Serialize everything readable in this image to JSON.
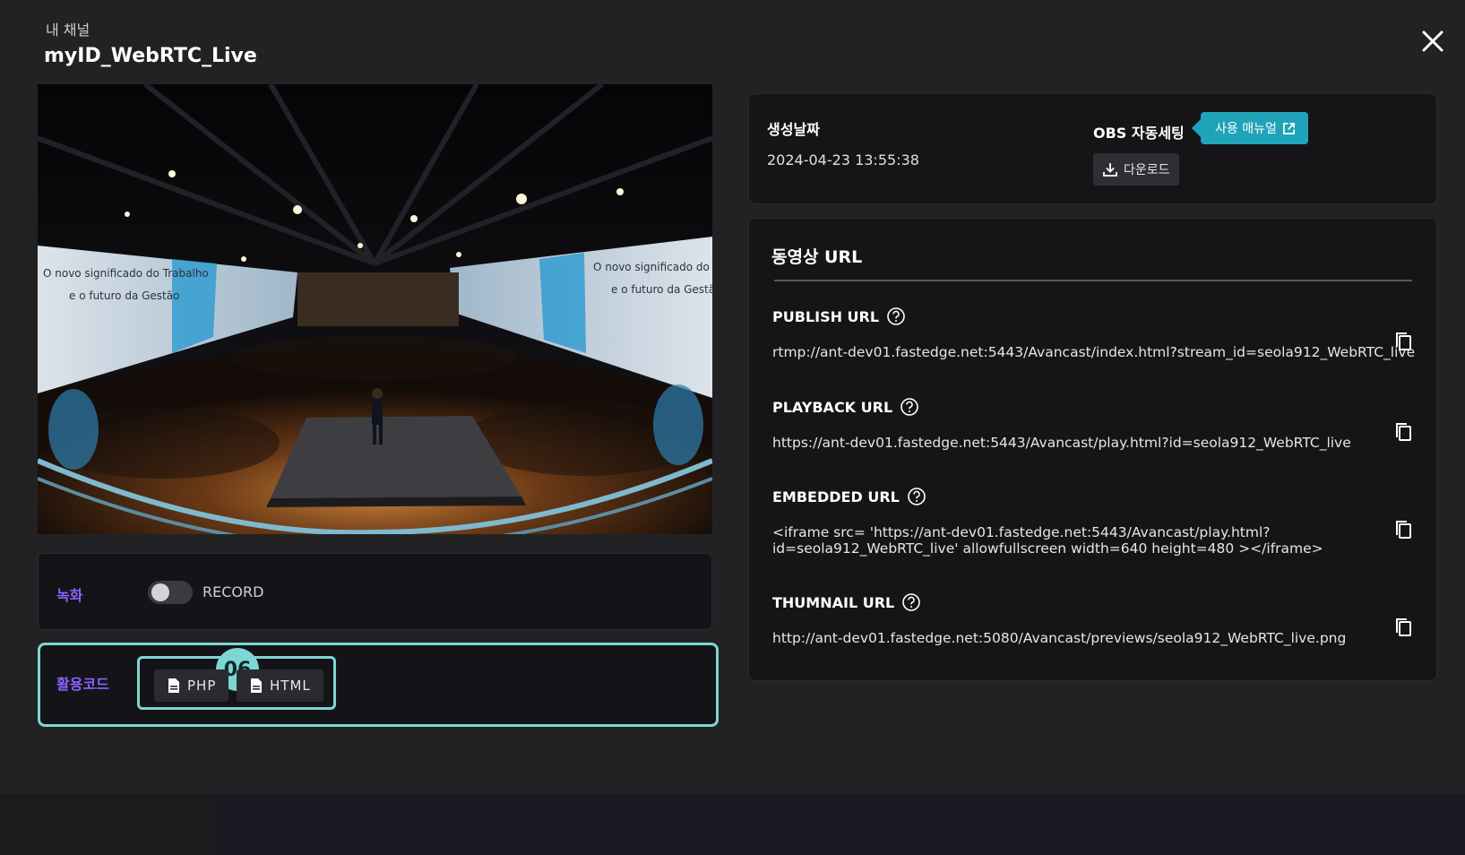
{
  "header": {
    "subtitle": "내 채널",
    "title": "myID_WebRTC_Live"
  },
  "recording": {
    "label": "녹화",
    "toggle_on": false,
    "toggle_text": "RECORD"
  },
  "code": {
    "label": "활용코드",
    "badge": "06",
    "buttons": [
      "PHP",
      "HTML"
    ]
  },
  "info": {
    "created_label": "생성날짜",
    "created_value": "2024-04-23 13:55:38",
    "obs_label": "OBS 자동세팅",
    "manual_button": "사용 매뉴얼",
    "download_button": "다운로드"
  },
  "urls": {
    "title": "동영상 URL",
    "items": [
      {
        "name": "PUBLISH URL",
        "value": "rtmp://ant-dev01.fastedge.net:5443/Avancast/index.html?stream_id=seola912_WebRTC_live",
        "value2": ""
      },
      {
        "name": "PLAYBACK URL",
        "value": "https://ant-dev01.fastedge.net:5443/Avancast/play.html?id=seola912_WebRTC_live",
        "value2": ""
      },
      {
        "name": "EMBEDDED URL",
        "value": "<iframe src= 'https://ant-dev01.fastedge.net:5443/Avancast/play.html?",
        "value2": "id=seola912_WebRTC_live' allowfullscreen width=640 height=480 ></iframe>"
      },
      {
        "name": "THUMNAIL URL",
        "value": "http://ant-dev01.fastedge.net:5080/Avancast/previews/seola912_WebRTC_live.png",
        "value2": ""
      }
    ]
  },
  "video": {
    "screen_text_left_1": "O novo significado do Trabalho",
    "screen_text_left_2": "e o futuro da Gestão",
    "screen_text_right_1": "O novo significado do Trabalho",
    "screen_text_right_2": "e o futuro da Gestão"
  },
  "colors": {
    "accent_purple": "#8a63ff",
    "highlight_teal": "#7ed6d3",
    "manual_button": "#1fa3b8"
  }
}
